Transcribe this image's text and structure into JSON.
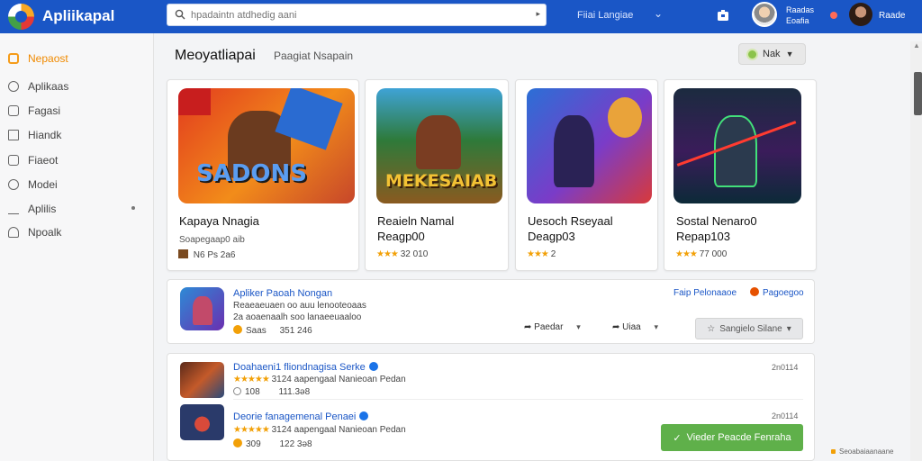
{
  "header": {
    "logo_text": "Apliikapal",
    "search_placeholder": "hpadaintn atdhedig aani",
    "language": "Fiiai Langiae",
    "user1_name_line1": "Raadas",
    "user1_name_line2": "Eoafia",
    "user2_name": "Raade"
  },
  "sidebar": {
    "items": [
      {
        "label": "Nepaost",
        "icon": "category-icon",
        "active": true
      },
      {
        "label": "Aplikaas",
        "icon": "apps-icon",
        "active": false
      },
      {
        "label": "Fagasi",
        "icon": "games-icon",
        "active": false
      },
      {
        "label": "Hiandk",
        "icon": "book-icon",
        "active": false
      },
      {
        "label": "Fiaeot",
        "icon": "file-icon",
        "active": false
      },
      {
        "label": "Modei",
        "icon": "search-icon",
        "active": false
      },
      {
        "label": "Aplilis",
        "icon": "upload-icon",
        "active": false
      },
      {
        "label": "Npoalk",
        "icon": "user-icon",
        "active": false
      }
    ]
  },
  "main": {
    "title": "Meoyatliapai",
    "subtitle": "Paagiat Nsapain",
    "filter_label": "Nak"
  },
  "cards": [
    {
      "title_line1": "Kapaya Nnagia",
      "title_line2": "",
      "meta": "Soapegaap0 aib",
      "rating": "N6 Ps 2a6",
      "stars": "",
      "art_text": "SADONS"
    },
    {
      "title_line1": "Reaieln Namal",
      "title_line2": "Reagp00",
      "meta": "",
      "rating": "32 010",
      "stars": "★★★",
      "art_text": "MEKESAIAB"
    },
    {
      "title_line1": "Uesoch Rseyaal",
      "title_line2": "Deagp03",
      "meta": "",
      "rating": "2",
      "stars": "★★★",
      "art_text": ""
    },
    {
      "title_line1": "Sostal Nenaro0",
      "title_line2": "Repap103",
      "meta": "",
      "rating": "77 000",
      "stars": "★★★",
      "art_text": ""
    }
  ],
  "featured": {
    "title": "Apliker Paoah Nongan",
    "desc_line1": "Reaeaeuaen oo auu lenooteoaas",
    "desc_line2": "2a aoaenaalh soo lanaeeuaaloo",
    "stats_a": "Saas",
    "stats_b": "351 246",
    "developer": "Faip Pelonaaoe",
    "category": "Pagoegoo",
    "action1": "Paedar",
    "action2": "Uiaa",
    "share_label": "Sangielo Silane"
  },
  "list": [
    {
      "title": "Doahaeni1 fliondnagisa Serke",
      "rating_text": "3124 aapengaal Nanieoan Pedan",
      "stats_a": "108",
      "stats_b": "111.3ə8",
      "date": "2n0114"
    },
    {
      "title": "Deorie fanagemenal Penaei",
      "rating_text": "3124 aapengaal Nanieoan Pedan",
      "stats_a": "309",
      "stats_b": "122 3ə8",
      "date": "2n0114"
    }
  ],
  "cta_label": "Vieder Peacde Fenraha",
  "footnote": "Seoabaiaanaane",
  "colors": {
    "topbar": "#1a56c6",
    "accent_orange": "#f08a00",
    "link_blue": "#1a56c6",
    "cta_green": "#5fb04a",
    "star": "#f2a007"
  }
}
